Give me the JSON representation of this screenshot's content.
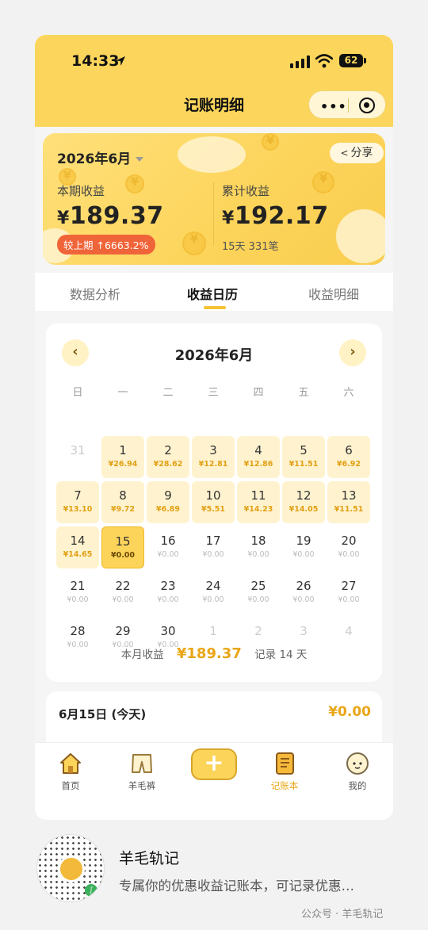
{
  "status": {
    "time": "14:33",
    "battery": "62"
  },
  "nav": {
    "title": "记账明细",
    "more_icon": "more-dots-icon",
    "target_icon": "target-icon"
  },
  "summary": {
    "month": "2026年6月",
    "share": "分享",
    "period_label": "本期收益",
    "period_value": "189.37",
    "compare": "较上期 ↑6663.2%",
    "total_label": "累计收益",
    "total_value": "192.17",
    "total_sub": "15天 331笔",
    "currency": "¥"
  },
  "tabs": [
    "数据分析",
    "收益日历",
    "收益明细"
  ],
  "calendar": {
    "title": "2026年6月",
    "prev": "‹",
    "next": "›",
    "weekdays": [
      "日",
      "一",
      "二",
      "三",
      "四",
      "五",
      "六"
    ],
    "days": [
      {
        "n": "31",
        "a": "",
        "s": "out"
      },
      {
        "n": "1",
        "a": "¥26.94",
        "s": "rec"
      },
      {
        "n": "2",
        "a": "¥28.62",
        "s": "rec"
      },
      {
        "n": "3",
        "a": "¥12.81",
        "s": "rec"
      },
      {
        "n": "4",
        "a": "¥12.86",
        "s": "rec"
      },
      {
        "n": "5",
        "a": "¥11.51",
        "s": "rec"
      },
      {
        "n": "6",
        "a": "¥6.92",
        "s": "rec"
      },
      {
        "n": "7",
        "a": "¥13.10",
        "s": "rec"
      },
      {
        "n": "8",
        "a": "¥9.72",
        "s": "rec"
      },
      {
        "n": "9",
        "a": "¥6.89",
        "s": "rec"
      },
      {
        "n": "10",
        "a": "¥5.51",
        "s": "rec"
      },
      {
        "n": "11",
        "a": "¥14.23",
        "s": "rec"
      },
      {
        "n": "12",
        "a": "¥14.05",
        "s": "rec"
      },
      {
        "n": "13",
        "a": "¥11.51",
        "s": "rec"
      },
      {
        "n": "14",
        "a": "¥14.65",
        "s": "rec"
      },
      {
        "n": "15",
        "a": "¥0.00",
        "s": "today"
      },
      {
        "n": "16",
        "a": "¥0.00",
        "s": "empty"
      },
      {
        "n": "17",
        "a": "¥0.00",
        "s": "empty"
      },
      {
        "n": "18",
        "a": "¥0.00",
        "s": "empty"
      },
      {
        "n": "19",
        "a": "¥0.00",
        "s": "empty"
      },
      {
        "n": "20",
        "a": "¥0.00",
        "s": "empty"
      },
      {
        "n": "21",
        "a": "¥0.00",
        "s": "empty"
      },
      {
        "n": "22",
        "a": "¥0.00",
        "s": "empty"
      },
      {
        "n": "23",
        "a": "¥0.00",
        "s": "empty"
      },
      {
        "n": "24",
        "a": "¥0.00",
        "s": "empty"
      },
      {
        "n": "25",
        "a": "¥0.00",
        "s": "empty"
      },
      {
        "n": "26",
        "a": "¥0.00",
        "s": "empty"
      },
      {
        "n": "27",
        "a": "¥0.00",
        "s": "empty"
      },
      {
        "n": "28",
        "a": "¥0.00",
        "s": "empty"
      },
      {
        "n": "29",
        "a": "¥0.00",
        "s": "empty"
      },
      {
        "n": "30",
        "a": "¥0.00",
        "s": "empty"
      },
      {
        "n": "1",
        "a": "",
        "s": "out"
      },
      {
        "n": "2",
        "a": "",
        "s": "out"
      },
      {
        "n": "3",
        "a": "",
        "s": "out"
      },
      {
        "n": "4",
        "a": "",
        "s": "out"
      }
    ],
    "foot_label": "本月收益",
    "foot_total": "¥189.37",
    "foot_record": "记录 14 天"
  },
  "today": {
    "date": "6月15日 (今天)",
    "value": "¥0.00"
  },
  "tabbar": [
    {
      "label": "首页",
      "icon": "home-icon"
    },
    {
      "label": "羊毛裤",
      "icon": "pants-icon"
    },
    {
      "label": "",
      "icon": "plus-icon"
    },
    {
      "label": "记账本",
      "icon": "notebook-icon",
      "active": true
    },
    {
      "label": "我的",
      "icon": "sheep-avatar-icon"
    }
  ],
  "article": {
    "title": "羊毛轨记",
    "desc": "专属你的优惠收益记账本，可记录优惠…",
    "source": "公众号 · 羊毛轨记"
  },
  "colors": {
    "brand_yellow": "#fcd65c",
    "accent_orange": "#e9a617",
    "badge_red": "#f0643a"
  }
}
